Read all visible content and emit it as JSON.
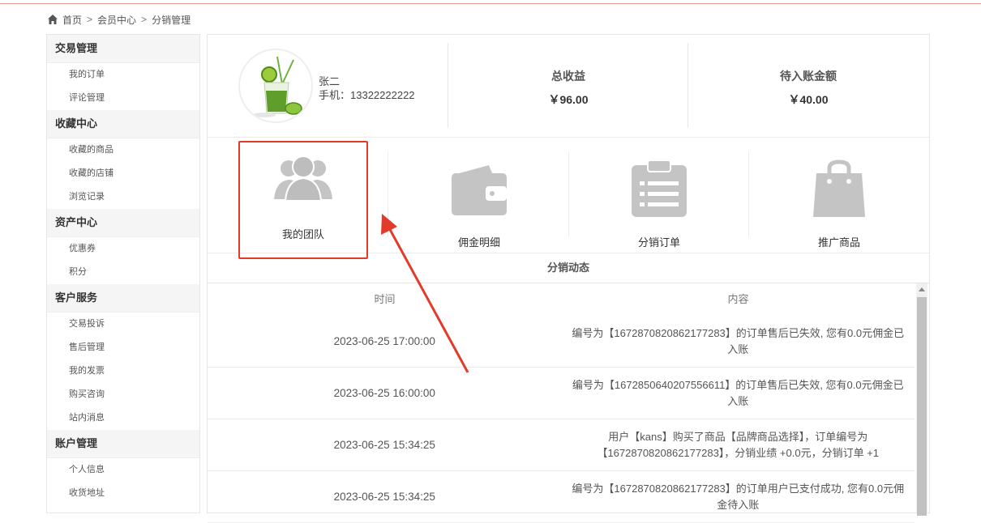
{
  "breadcrumb": [
    "首页",
    "会员中心",
    "分销管理"
  ],
  "sidebar": [
    {
      "title": "交易管理",
      "items": [
        "我的订单",
        "评论管理"
      ]
    },
    {
      "title": "收藏中心",
      "items": [
        "收藏的商品",
        "收藏的店铺",
        "浏览记录"
      ]
    },
    {
      "title": "资产中心",
      "items": [
        "优惠券",
        "积分"
      ]
    },
    {
      "title": "客户服务",
      "items": [
        "交易投诉",
        "售后管理",
        "我的发票",
        "购买咨询",
        "站内消息"
      ]
    },
    {
      "title": "账户管理",
      "items": [
        "个人信息",
        "收货地址"
      ]
    }
  ],
  "profile": {
    "name": "张二",
    "phone": "手机：13322222222"
  },
  "stats": [
    {
      "label": "总收益",
      "value": "￥96.00"
    },
    {
      "label": "待入账金额",
      "value": "￥40.00"
    }
  ],
  "features": [
    {
      "label": "我的团队",
      "icon": "team-icon"
    },
    {
      "label": "佣金明细",
      "icon": "wallet-icon"
    },
    {
      "label": "分销订单",
      "icon": "clipboard-icon"
    },
    {
      "label": "推广商品",
      "icon": "shopping-bag-icon"
    }
  ],
  "dynamics": {
    "title": "分销动态",
    "headers": [
      "时间",
      "内容"
    ],
    "rows": [
      {
        "time": "2023-06-25 17:00:00",
        "content": "编号为【1672870820862177283】的订单售后已失效, 您有0.0元佣金已入账"
      },
      {
        "time": "2023-06-25 16:00:00",
        "content": "编号为【1672850640207556611】的订单售后已失效, 您有0.0元佣金已入账"
      },
      {
        "time": "2023-06-25 15:34:25",
        "content": "用户【kans】购买了商品【品牌商品选择】，订单编号为【1672870820862177283】，分销业绩 +0.0元，分销订单 +1"
      },
      {
        "time": "2023-06-25 15:34:25",
        "content": "编号为【1672870820862177283】的订单用户已支付成功, 您有0.0元佣金待入账"
      }
    ]
  },
  "colors": {
    "accent_red": "#e33b2b",
    "icon_gray": "#c4c4c4"
  }
}
